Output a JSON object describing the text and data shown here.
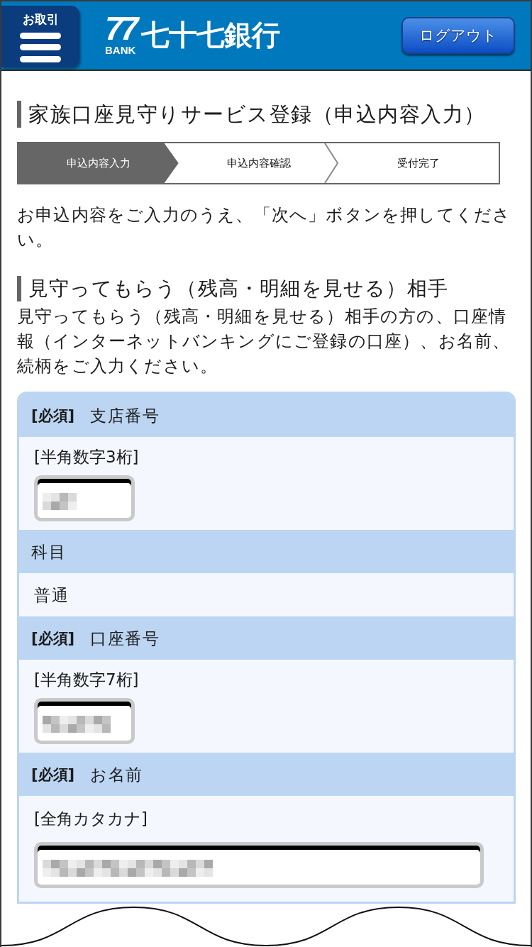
{
  "header": {
    "menu_button": {
      "caption": "お取引"
    },
    "logo": {
      "numerals": "77",
      "subtitle": "BANK",
      "name": "七十七銀行"
    },
    "logout_button": {
      "label": "ログアウト"
    }
  },
  "page_title": "家族口座見守りサービス登録（申込内容入力）",
  "steps": [
    {
      "label": "申込内容入力",
      "selected": true
    },
    {
      "label": "申込内容確認",
      "selected": false
    },
    {
      "label": "受付完了",
      "selected": false
    }
  ],
  "intro": "お申込内容をご入力のうえ、「次へ」ボタンを押してください。",
  "section": {
    "title": "見守ってもらう（残高・明細を見せる）相手",
    "description": "見守ってもらう（残高・明細を見せる）相手の方の、口座情報（インターネットバンキングにご登録の口座）、お名前、続柄をご入力ください。"
  },
  "form": {
    "fields": [
      {
        "required_tag": "[必須]",
        "label": "支店番号",
        "kind": "numeric",
        "hint": "[半角数字3桁]",
        "redacted": true
      },
      {
        "label": "科目",
        "kind": "static",
        "value": "普通"
      },
      {
        "required_tag": "[必須]",
        "label": "口座番号",
        "kind": "numeric",
        "hint": "[半角数字7桁]",
        "redacted": true
      },
      {
        "required_tag": "[必須]",
        "label": "お名前",
        "kind": "text",
        "hint": "[全角カタカナ]",
        "redacted": true
      }
    ]
  }
}
